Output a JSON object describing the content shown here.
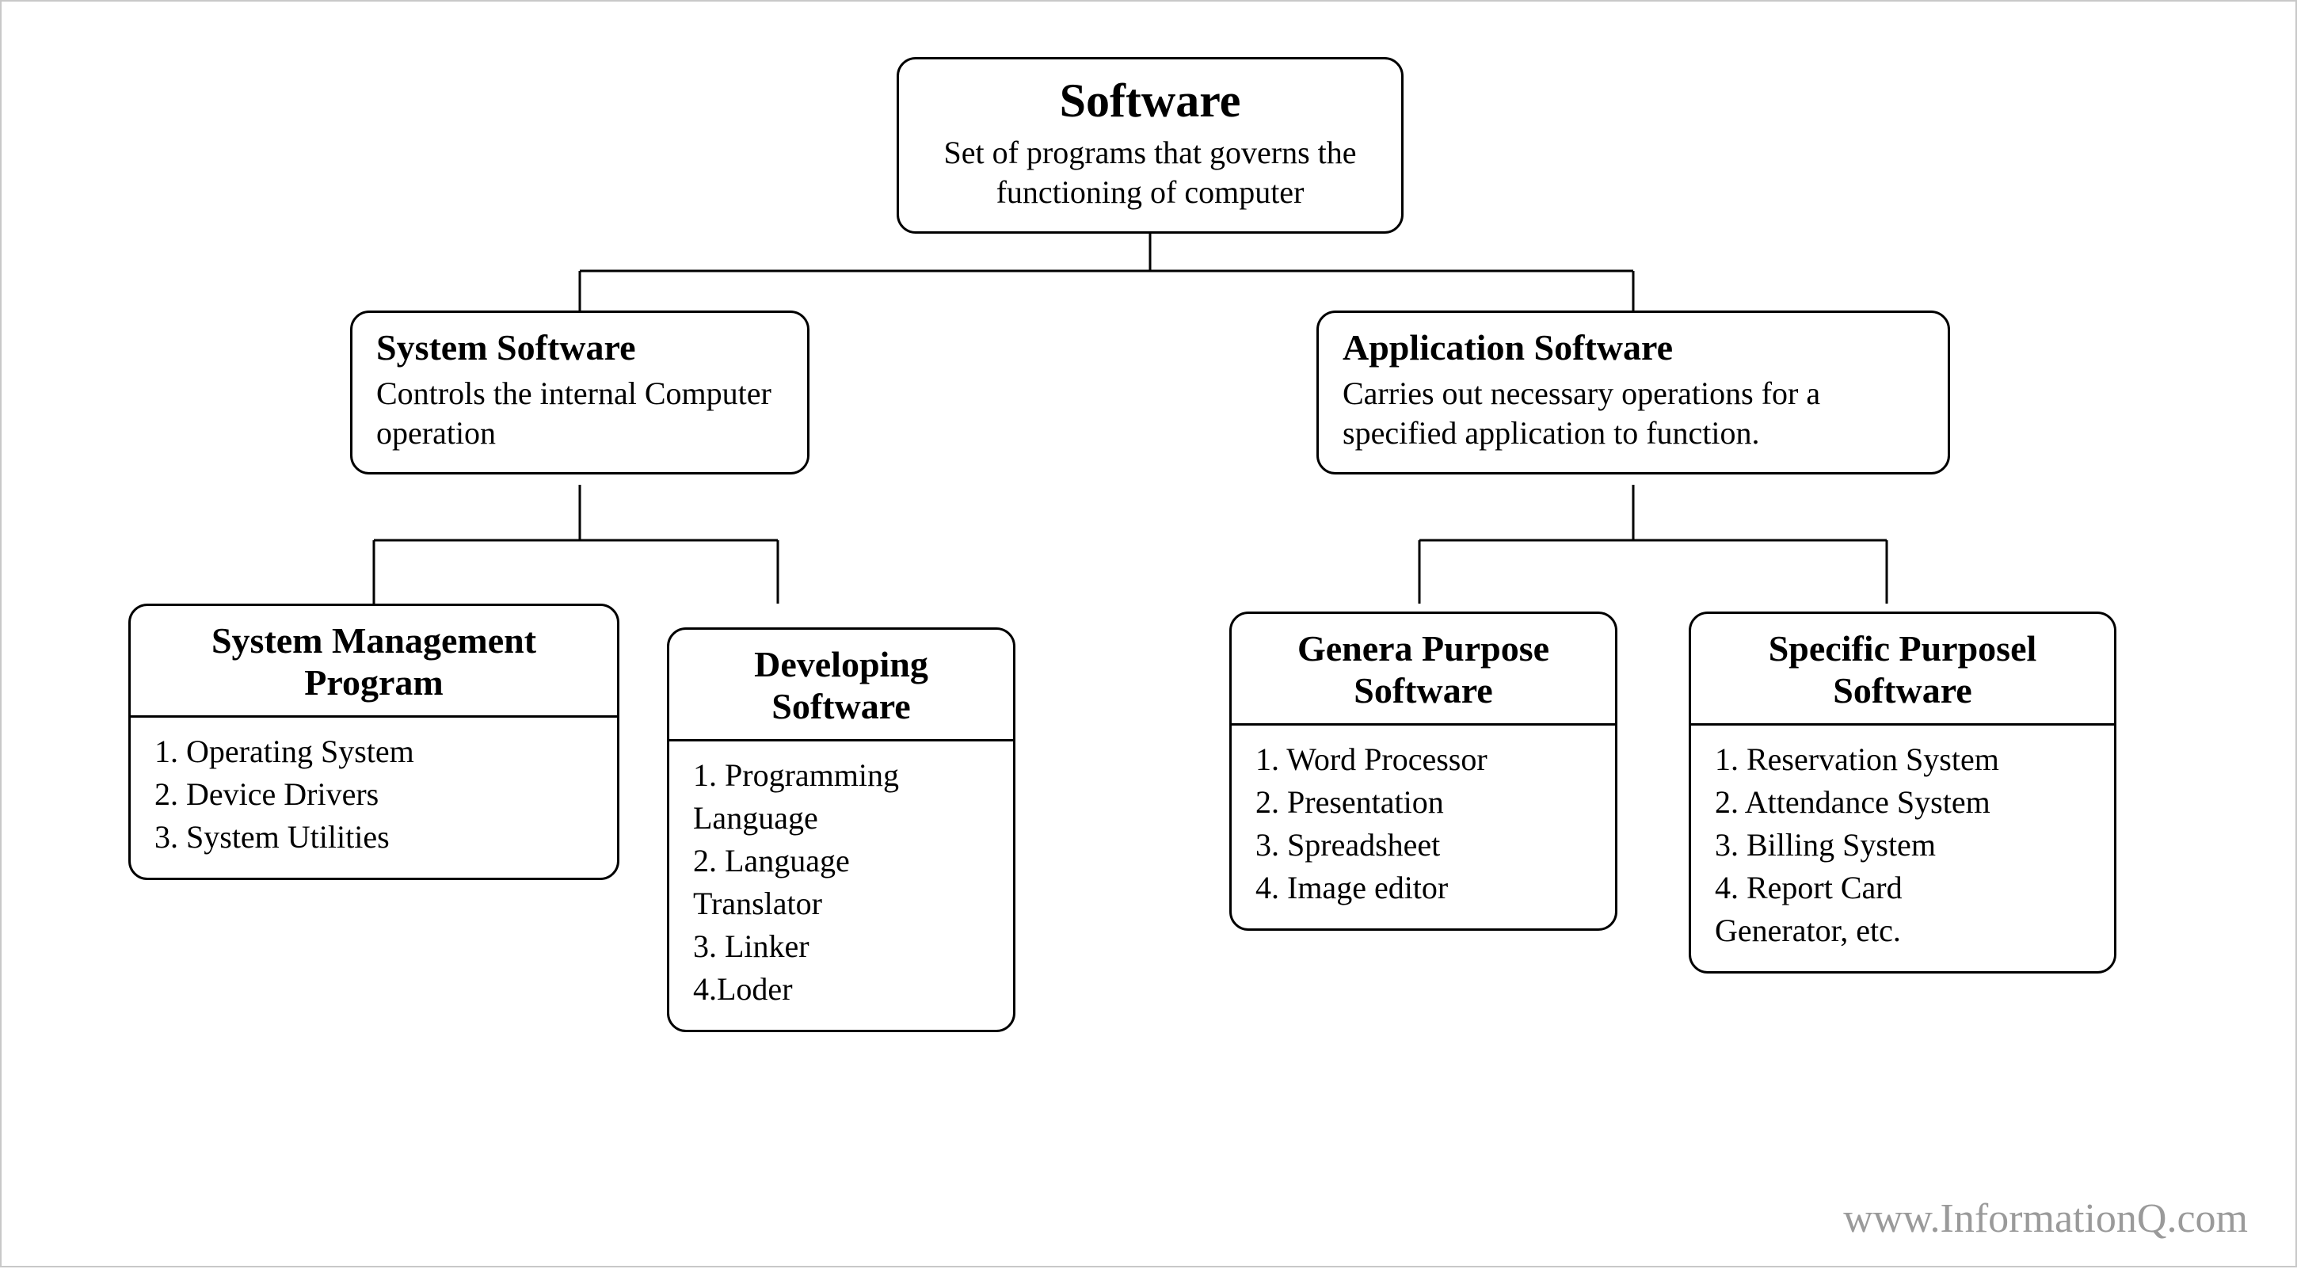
{
  "root": {
    "title": "Software",
    "subtitle": "Set of programs that governs\nthe  functioning of computer"
  },
  "level2": {
    "system": {
      "title": "System Software",
      "subtitle": "Controls the internal\nComputer operation"
    },
    "application": {
      "title": "Application Software",
      "subtitle": "Carries out necessary operations for\na specified application to function."
    }
  },
  "leaves": {
    "system_management": {
      "title": "System\nManagement Program",
      "items": "1. Operating System\n2. Device Drivers\n3. System Utilities"
    },
    "developing": {
      "title": "Developing\nSoftware",
      "items": "1. Programming\nLanguage\n2. Language\nTranslator\n3. Linker\n4.Loder"
    },
    "general_purpose": {
      "title": "Genera\nPurpose Software",
      "items": "1. Word Processor\n2. Presentation\n3. Spreadsheet\n4. Image editor"
    },
    "specific_purpose": {
      "title": "Specific Purposel\nSoftware",
      "items": "1. Reservation System\n2. Attendance System\n3. Billing System\n4. Report Card\nGenerator, etc."
    }
  },
  "watermark": "www.InformationQ.com"
}
